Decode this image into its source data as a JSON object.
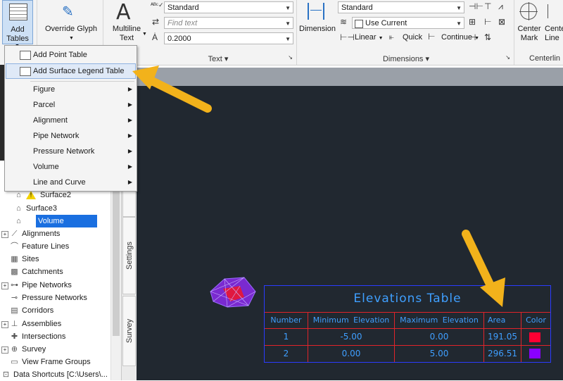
{
  "ribbon": {
    "add_tables_label_1": "Add",
    "add_tables_label_2": "Tables",
    "override_glyph_label": "Override Glyph",
    "multiline_label_1": "Multiline",
    "multiline_label_2": "Text",
    "text_style_value": "Standard",
    "find_text_placeholder": "Find text",
    "text_height_value": "0.2000",
    "text_panel_title": "Text",
    "dimension_label": "Dimension",
    "dim_style_value": "Standard",
    "use_current_value": "Use Current",
    "linear_label": "Linear",
    "quick_label": "Quick",
    "continue_label": "Continue",
    "dimensions_panel_title": "Dimensions",
    "center_mark_label_1": "Center",
    "center_mark_label_2": "Mark",
    "centerline_label_1": "Center",
    "centerline_label_2": "Line",
    "centerlines_panel_title": "Centerlin"
  },
  "menu": {
    "items": [
      {
        "label": "Add Point Table"
      },
      {
        "label": "Add Surface Legend Table"
      },
      {
        "label": "Figure"
      },
      {
        "label": "Parcel"
      },
      {
        "label": "Alignment"
      },
      {
        "label": "Pipe Network"
      },
      {
        "label": "Pressure Network"
      },
      {
        "label": "Volume"
      },
      {
        "label": "Line and Curve"
      }
    ]
  },
  "tree": {
    "surface2": "Surface2",
    "surface3": "Surface3",
    "volume": "Volume",
    "alignments": "Alignments",
    "feature_lines": "Feature Lines",
    "sites": "Sites",
    "catchments": "Catchments",
    "pipe_networks": "Pipe Networks",
    "pressure_networks": "Pressure Networks",
    "corridors": "Corridors",
    "assemblies": "Assemblies",
    "intersections": "Intersections",
    "survey": "Survey",
    "view_frame_groups": "View Frame Groups",
    "data_shortcuts": "Data Shortcuts [C:\\Users\\..."
  },
  "side_tabs": {
    "settings": "Settings",
    "survey": "Survey"
  },
  "elevations_table": {
    "title": "Elevations Table",
    "headers": [
      "Number",
      "Minimum Elevation",
      "Maximum Elevation",
      "Area",
      "Color"
    ],
    "rows": [
      {
        "number": "1",
        "min": "-5.00",
        "max": "0.00",
        "area": "191.05",
        "color": "#ff0033"
      },
      {
        "number": "2",
        "min": "0.00",
        "max": "5.00",
        "area": "296.51",
        "color": "#8a00ff"
      }
    ]
  },
  "colors": {
    "table_border": "#2b3cff",
    "table_grid": "#e0242a",
    "table_text": "#3f9fff",
    "canvas_bg": "#212830",
    "callout_arrow": "#f2b21b"
  }
}
